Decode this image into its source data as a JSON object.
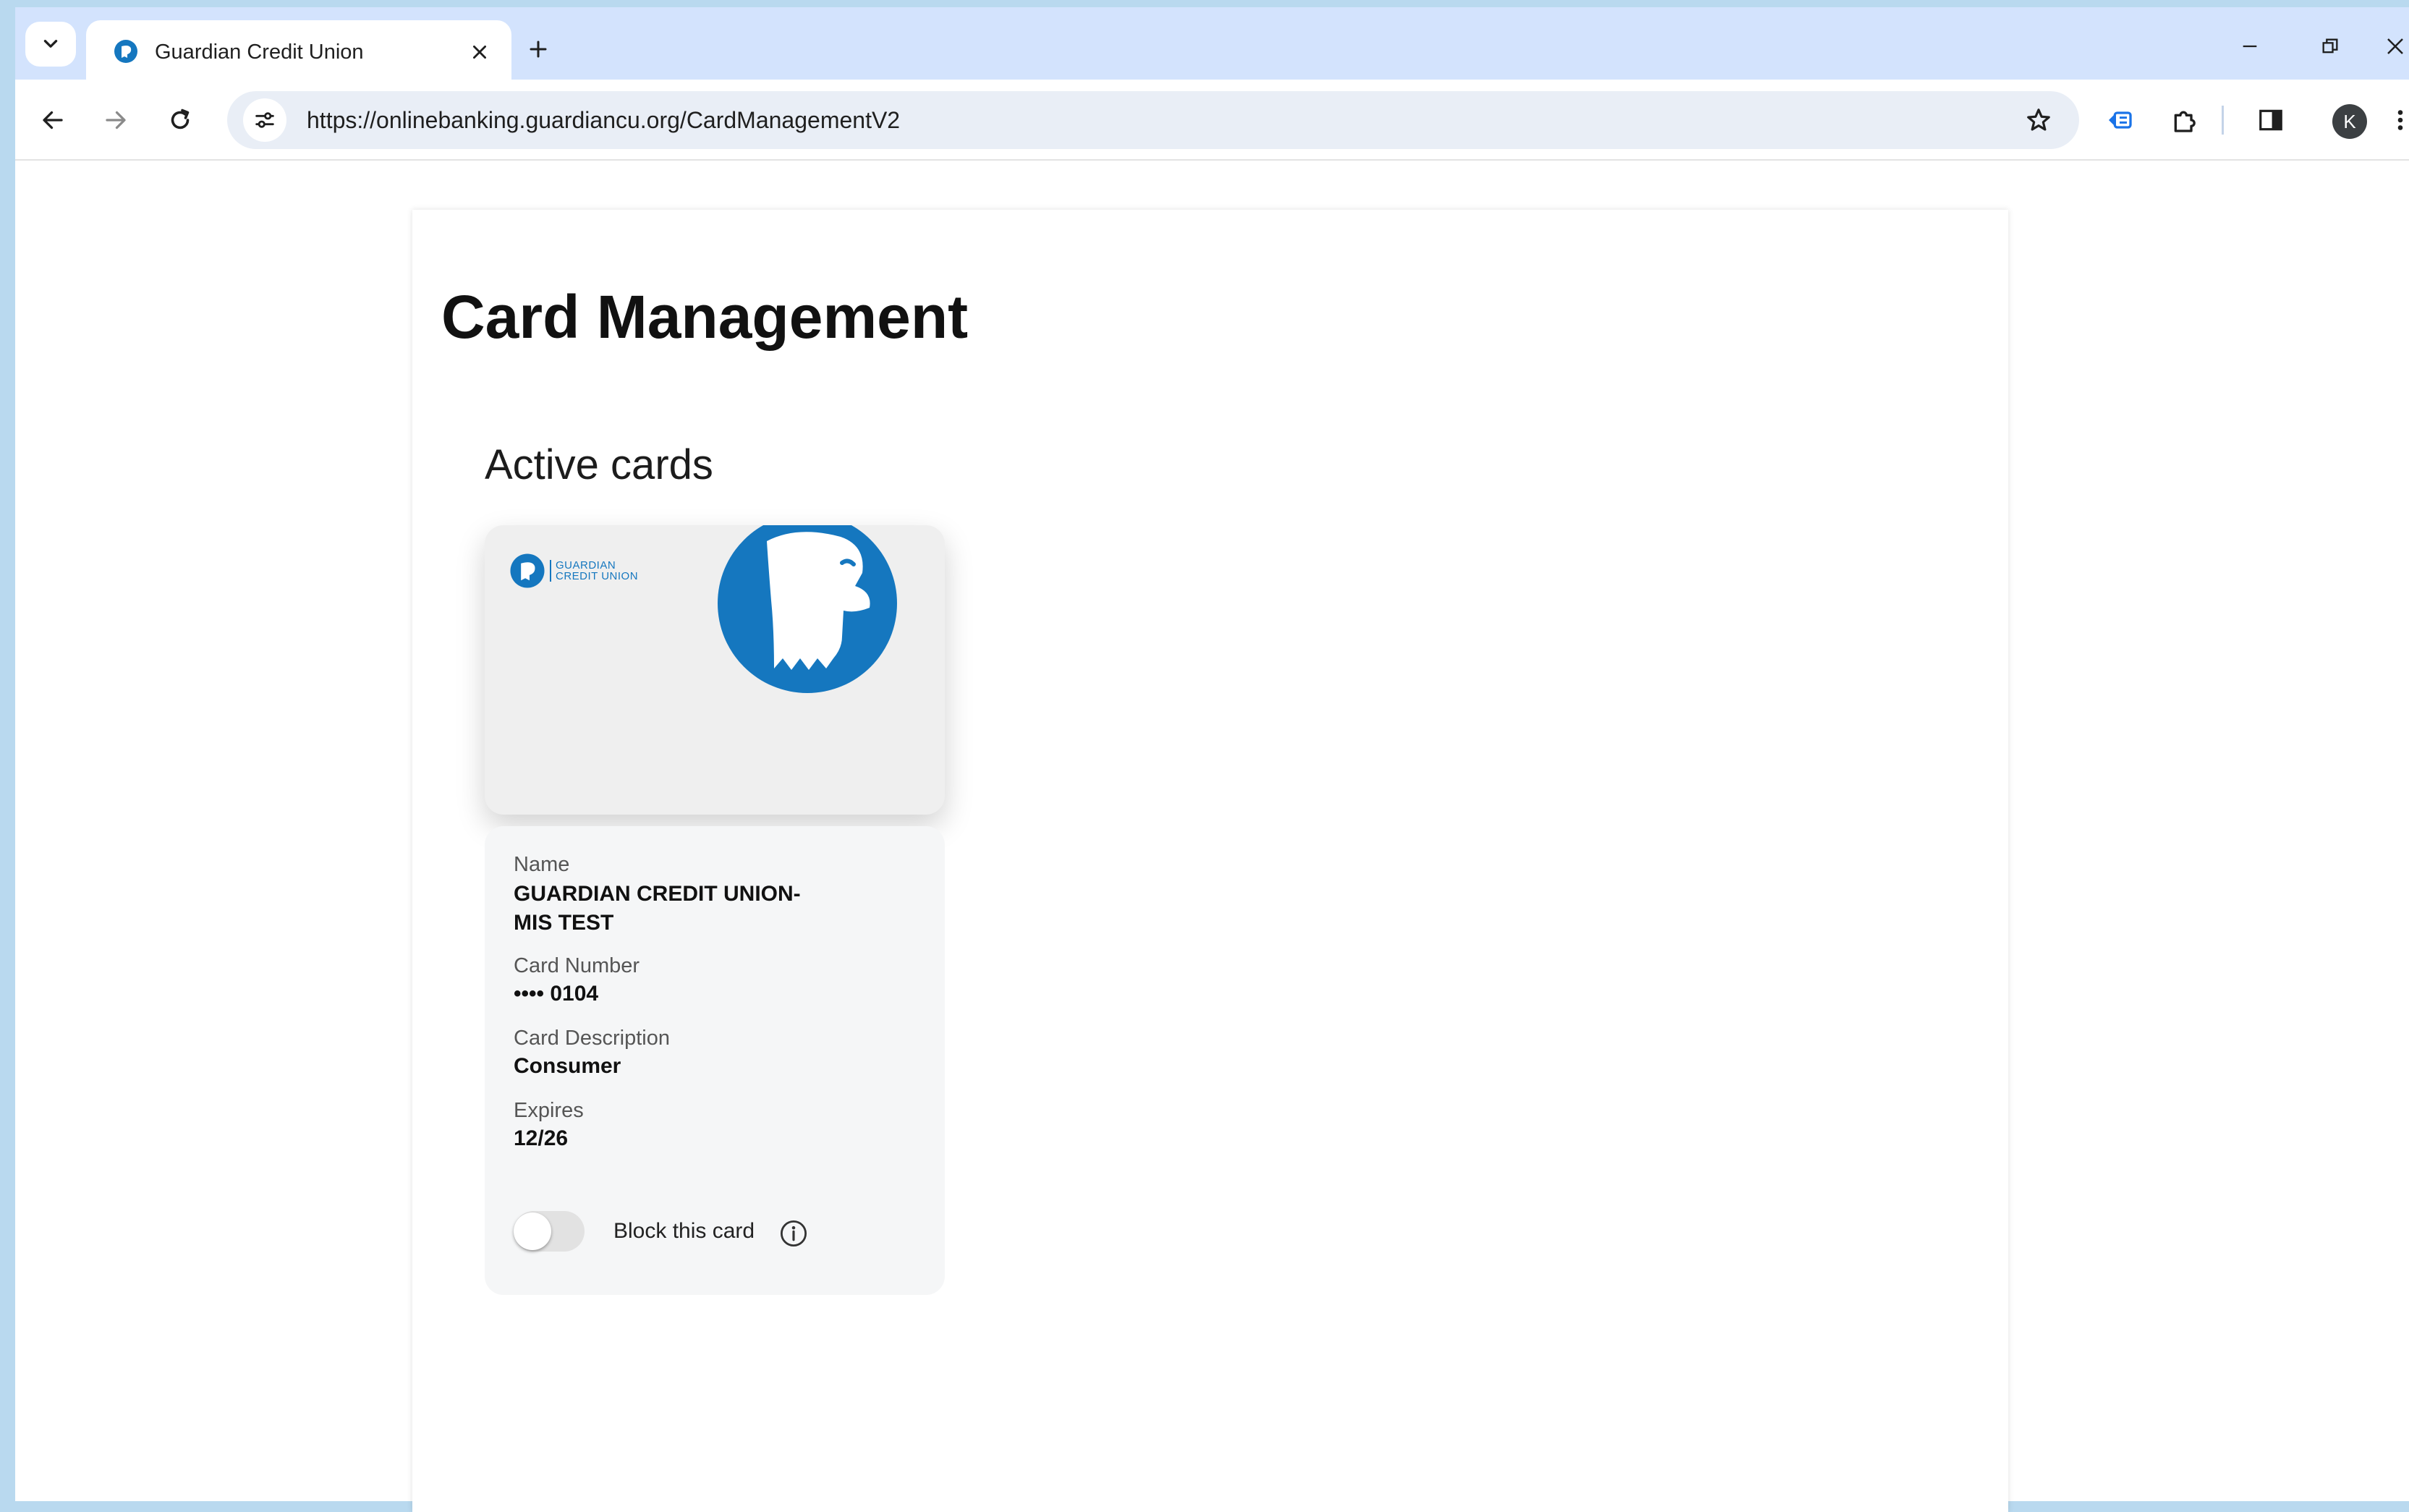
{
  "browser": {
    "tab_title": "Guardian Credit Union",
    "url": "https://onlinebanking.guardiancu.org/CardManagementV2",
    "profile_initial": "K"
  },
  "page": {
    "title": "Card Management",
    "section_title": "Active cards"
  },
  "card": {
    "brand_line1": "GUARDIAN",
    "brand_line2": "CREDIT UNION",
    "fields": {
      "name_label": "Name",
      "name_value": "GUARDIAN CREDIT UNION-MIS TEST",
      "number_label": "Card Number",
      "number_value": "•••• 0104",
      "description_label": "Card Description",
      "description_value": "Consumer",
      "expires_label": "Expires",
      "expires_value": "12/26"
    },
    "block_toggle_label": "Block this card",
    "block_toggle_on": false
  },
  "colors": {
    "brand_blue": "#1577bf",
    "tabstrip_bg": "#d3e3fd",
    "window_border": "#b9d9ef"
  },
  "icons": {
    "tab_search": "chevron-down-icon",
    "favicon": "guardian-favicon-icon",
    "tab_close": "close-icon",
    "new_tab": "plus-icon",
    "back": "back-arrow-icon",
    "forward": "forward-arrow-icon",
    "reload": "reload-icon",
    "site_info": "tune-icon",
    "bookmark": "star-icon",
    "extension_1": "extension-card-icon",
    "extensions": "puzzle-icon",
    "side_panel": "side-panel-icon",
    "menu": "kebab-menu-icon",
    "info": "info-icon"
  }
}
